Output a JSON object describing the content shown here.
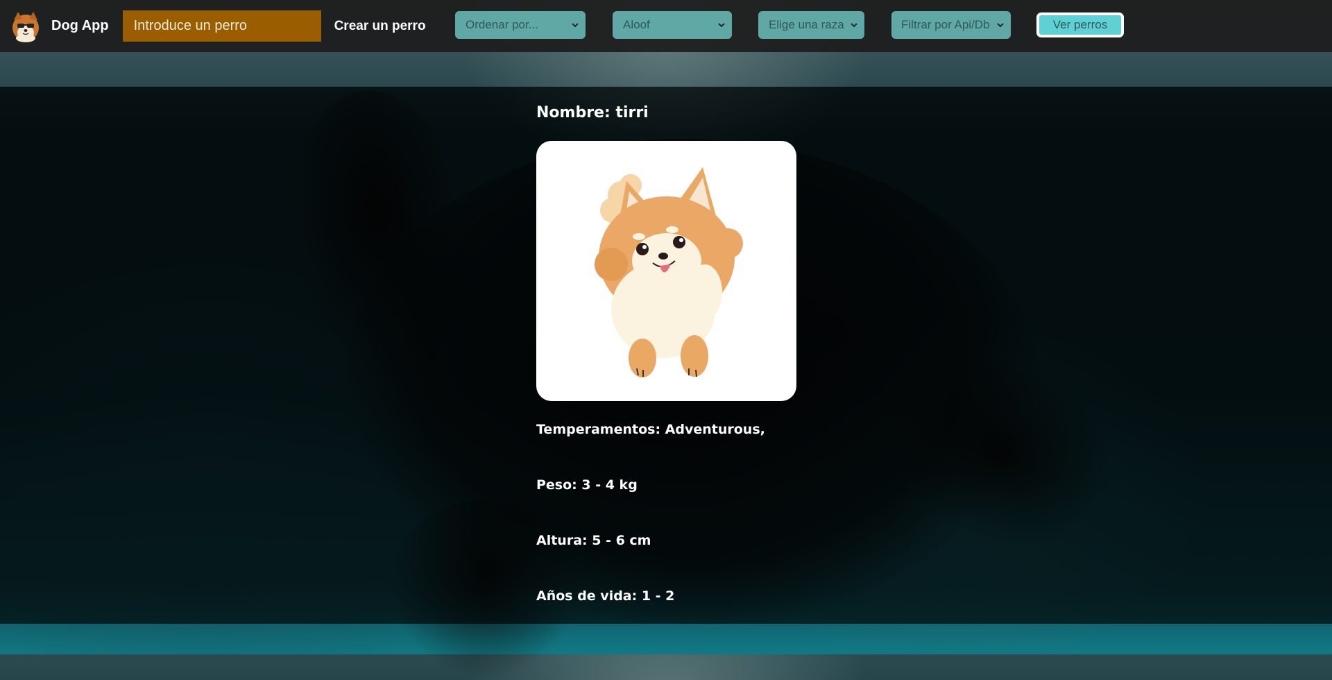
{
  "navbar": {
    "brand": "Dog App",
    "search_placeholder": "Introduce un perro",
    "create_link": "Crear un perro",
    "sort_select": "Ordenar por...",
    "temperament_select": "Aloof",
    "breed_select": "Elige una raza",
    "source_select": "Filtrar por Api/Db",
    "view_button": "Ver perros"
  },
  "detail": {
    "name": "Nombre: tirri",
    "temperaments": "Temperamentos: Adventurous,",
    "weight": "Peso: 3 - 4 kg",
    "height": "Altura: 5 - 6 cm",
    "life_span": "Años de vida: 1 - 2"
  },
  "colors": {
    "search_bg": "#9a5e00",
    "select_bg": "#5fa8a6",
    "button_bg": "#5fd0d4"
  },
  "icons": [
    "pomeranian-logo",
    "chevron-down-icon",
    "pomeranian-illustration"
  ]
}
